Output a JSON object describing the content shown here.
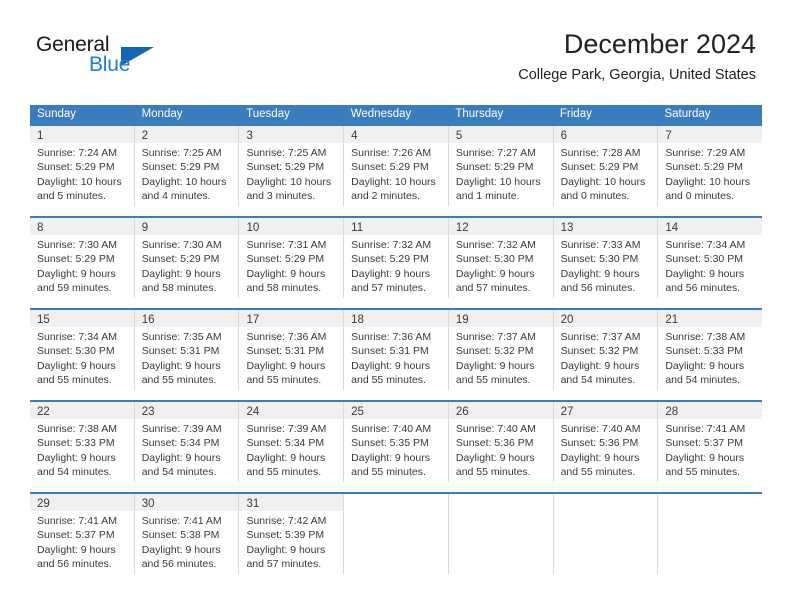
{
  "logo": {
    "word_one": "General",
    "word_two": "Blue",
    "triangle_color": "#1565b5",
    "blue_color": "#1c7fd4"
  },
  "header": {
    "month_title": "December 2024",
    "location": "College Park, Georgia, United States"
  },
  "theme": {
    "header_blue": "#3a7dbf",
    "daynum_band": "#f0f0f0",
    "cell_border": "#d8d8d8",
    "text": "#3a3a3a"
  },
  "calendar": {
    "weekday_headers": [
      "Sunday",
      "Monday",
      "Tuesday",
      "Wednesday",
      "Thursday",
      "Friday",
      "Saturday"
    ],
    "weeks": [
      [
        {
          "day": "1",
          "lines": [
            "Sunrise: 7:24 AM",
            "Sunset: 5:29 PM",
            "Daylight: 10 hours",
            "and 5 minutes."
          ]
        },
        {
          "day": "2",
          "lines": [
            "Sunrise: 7:25 AM",
            "Sunset: 5:29 PM",
            "Daylight: 10 hours",
            "and 4 minutes."
          ]
        },
        {
          "day": "3",
          "lines": [
            "Sunrise: 7:25 AM",
            "Sunset: 5:29 PM",
            "Daylight: 10 hours",
            "and 3 minutes."
          ]
        },
        {
          "day": "4",
          "lines": [
            "Sunrise: 7:26 AM",
            "Sunset: 5:29 PM",
            "Daylight: 10 hours",
            "and 2 minutes."
          ]
        },
        {
          "day": "5",
          "lines": [
            "Sunrise: 7:27 AM",
            "Sunset: 5:29 PM",
            "Daylight: 10 hours",
            "and 1 minute."
          ]
        },
        {
          "day": "6",
          "lines": [
            "Sunrise: 7:28 AM",
            "Sunset: 5:29 PM",
            "Daylight: 10 hours",
            "and 0 minutes."
          ]
        },
        {
          "day": "7",
          "lines": [
            "Sunrise: 7:29 AM",
            "Sunset: 5:29 PM",
            "Daylight: 10 hours",
            "and 0 minutes."
          ]
        }
      ],
      [
        {
          "day": "8",
          "lines": [
            "Sunrise: 7:30 AM",
            "Sunset: 5:29 PM",
            "Daylight: 9 hours",
            "and 59 minutes."
          ]
        },
        {
          "day": "9",
          "lines": [
            "Sunrise: 7:30 AM",
            "Sunset: 5:29 PM",
            "Daylight: 9 hours",
            "and 58 minutes."
          ]
        },
        {
          "day": "10",
          "lines": [
            "Sunrise: 7:31 AM",
            "Sunset: 5:29 PM",
            "Daylight: 9 hours",
            "and 58 minutes."
          ]
        },
        {
          "day": "11",
          "lines": [
            "Sunrise: 7:32 AM",
            "Sunset: 5:29 PM",
            "Daylight: 9 hours",
            "and 57 minutes."
          ]
        },
        {
          "day": "12",
          "lines": [
            "Sunrise: 7:32 AM",
            "Sunset: 5:30 PM",
            "Daylight: 9 hours",
            "and 57 minutes."
          ]
        },
        {
          "day": "13",
          "lines": [
            "Sunrise: 7:33 AM",
            "Sunset: 5:30 PM",
            "Daylight: 9 hours",
            "and 56 minutes."
          ]
        },
        {
          "day": "14",
          "lines": [
            "Sunrise: 7:34 AM",
            "Sunset: 5:30 PM",
            "Daylight: 9 hours",
            "and 56 minutes."
          ]
        }
      ],
      [
        {
          "day": "15",
          "lines": [
            "Sunrise: 7:34 AM",
            "Sunset: 5:30 PM",
            "Daylight: 9 hours",
            "and 55 minutes."
          ]
        },
        {
          "day": "16",
          "lines": [
            "Sunrise: 7:35 AM",
            "Sunset: 5:31 PM",
            "Daylight: 9 hours",
            "and 55 minutes."
          ]
        },
        {
          "day": "17",
          "lines": [
            "Sunrise: 7:36 AM",
            "Sunset: 5:31 PM",
            "Daylight: 9 hours",
            "and 55 minutes."
          ]
        },
        {
          "day": "18",
          "lines": [
            "Sunrise: 7:36 AM",
            "Sunset: 5:31 PM",
            "Daylight: 9 hours",
            "and 55 minutes."
          ]
        },
        {
          "day": "19",
          "lines": [
            "Sunrise: 7:37 AM",
            "Sunset: 5:32 PM",
            "Daylight: 9 hours",
            "and 55 minutes."
          ]
        },
        {
          "day": "20",
          "lines": [
            "Sunrise: 7:37 AM",
            "Sunset: 5:32 PM",
            "Daylight: 9 hours",
            "and 54 minutes."
          ]
        },
        {
          "day": "21",
          "lines": [
            "Sunrise: 7:38 AM",
            "Sunset: 5:33 PM",
            "Daylight: 9 hours",
            "and 54 minutes."
          ]
        }
      ],
      [
        {
          "day": "22",
          "lines": [
            "Sunrise: 7:38 AM",
            "Sunset: 5:33 PM",
            "Daylight: 9 hours",
            "and 54 minutes."
          ]
        },
        {
          "day": "23",
          "lines": [
            "Sunrise: 7:39 AM",
            "Sunset: 5:34 PM",
            "Daylight: 9 hours",
            "and 54 minutes."
          ]
        },
        {
          "day": "24",
          "lines": [
            "Sunrise: 7:39 AM",
            "Sunset: 5:34 PM",
            "Daylight: 9 hours",
            "and 55 minutes."
          ]
        },
        {
          "day": "25",
          "lines": [
            "Sunrise: 7:40 AM",
            "Sunset: 5:35 PM",
            "Daylight: 9 hours",
            "and 55 minutes."
          ]
        },
        {
          "day": "26",
          "lines": [
            "Sunrise: 7:40 AM",
            "Sunset: 5:36 PM",
            "Daylight: 9 hours",
            "and 55 minutes."
          ]
        },
        {
          "day": "27",
          "lines": [
            "Sunrise: 7:40 AM",
            "Sunset: 5:36 PM",
            "Daylight: 9 hours",
            "and 55 minutes."
          ]
        },
        {
          "day": "28",
          "lines": [
            "Sunrise: 7:41 AM",
            "Sunset: 5:37 PM",
            "Daylight: 9 hours",
            "and 55 minutes."
          ]
        }
      ],
      [
        {
          "day": "29",
          "lines": [
            "Sunrise: 7:41 AM",
            "Sunset: 5:37 PM",
            "Daylight: 9 hours",
            "and 56 minutes."
          ]
        },
        {
          "day": "30",
          "lines": [
            "Sunrise: 7:41 AM",
            "Sunset: 5:38 PM",
            "Daylight: 9 hours",
            "and 56 minutes."
          ]
        },
        {
          "day": "31",
          "lines": [
            "Sunrise: 7:42 AM",
            "Sunset: 5:39 PM",
            "Daylight: 9 hours",
            "and 57 minutes."
          ]
        },
        {
          "day": "",
          "lines": []
        },
        {
          "day": "",
          "lines": []
        },
        {
          "day": "",
          "lines": []
        },
        {
          "day": "",
          "lines": []
        }
      ]
    ]
  }
}
